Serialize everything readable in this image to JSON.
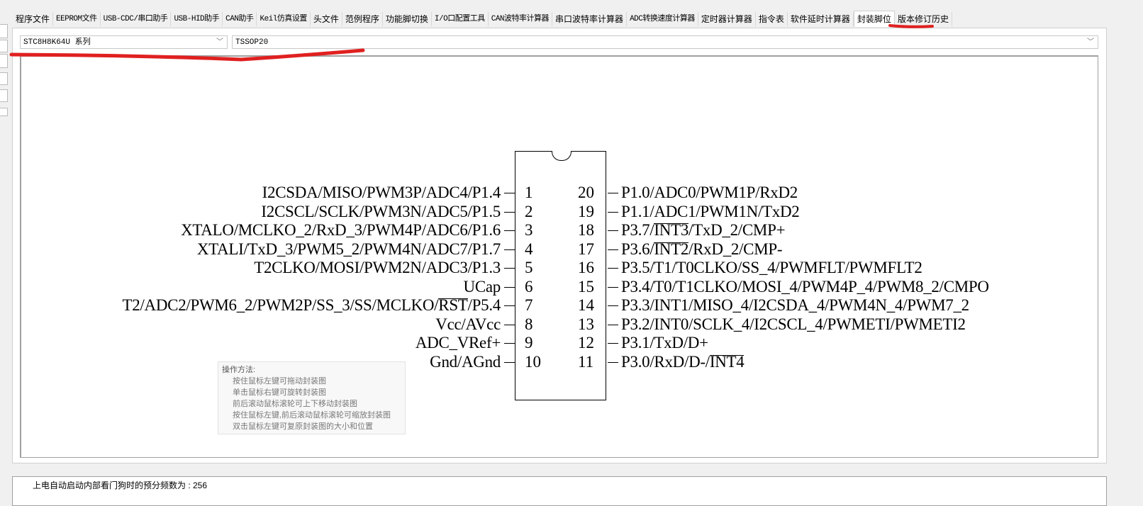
{
  "tabs": [
    {
      "label": "程序文件"
    },
    {
      "label": "EEPROM文件",
      "mono": true
    },
    {
      "label": "USB-CDC/串口助手",
      "mono": true
    },
    {
      "label": "USB-HID助手",
      "mono": true
    },
    {
      "label": "CAN助手",
      "mono": true
    },
    {
      "label": "Keil仿真设置",
      "mono": true
    },
    {
      "label": "头文件"
    },
    {
      "label": "范例程序"
    },
    {
      "label": "功能脚切换"
    },
    {
      "label": "I/O口配置工具",
      "mono": true
    },
    {
      "label": "CAN波特率计算器",
      "mono": true
    },
    {
      "label": "串口波特率计算器"
    },
    {
      "label": "ADC转换速度计算器",
      "mono": true
    },
    {
      "label": "定时器计算器"
    },
    {
      "label": "指令表"
    },
    {
      "label": "软件延时计算器"
    },
    {
      "label": "封装脚位",
      "active": true
    },
    {
      "label": "版本修订历史"
    }
  ],
  "series_select": {
    "value": "STC8H8K64U 系列"
  },
  "package_select": {
    "value": "TSSOP20"
  },
  "chip": {
    "left_pins": [
      {
        "num": "1",
        "label": "I2CSDA/MISO/PWM3P/ADC4/P1.4"
      },
      {
        "num": "2",
        "label": "I2CSCL/SCLK/PWM3N/ADC5/P1.5"
      },
      {
        "num": "3",
        "label": "XTALO/MCLKO_2/RxD_3/PWM4P/ADC6/P1.6"
      },
      {
        "num": "4",
        "label": "XTALI/TxD_3/PWM5_2/PWM4N/ADC7/P1.7"
      },
      {
        "num": "5",
        "label": "T2CLKO/MOSI/PWM2N/ADC3/P1.3"
      },
      {
        "num": "6",
        "label": "UCap"
      },
      {
        "num": "7",
        "label": "T2/ADC2/PWM6_2/PWM2P/SS_3/SS/MCLKO/RST/P5.4",
        "overline": "RST"
      },
      {
        "num": "8",
        "label": "Vcc/AVcc"
      },
      {
        "num": "9",
        "label": "ADC_VRef+"
      },
      {
        "num": "10",
        "label": "Gnd/AGnd"
      }
    ],
    "right_pins": [
      {
        "num": "20",
        "label": "P1.0/ADC0/PWM1P/RxD2"
      },
      {
        "num": "19",
        "label": "P1.1/ADC1/PWM1N/TxD2"
      },
      {
        "num": "18",
        "label": "P3.7/INT3/TxD_2/CMP+",
        "overline": "INT3"
      },
      {
        "num": "17",
        "label": "P3.6/INT2/RxD_2/CMP-",
        "overline": "INT2"
      },
      {
        "num": "16",
        "label": "P3.5/T1/T0CLKO/SS_4/PWMFLT/PWMFLT2"
      },
      {
        "num": "15",
        "label": "P3.4/T0/T1CLKO/MOSI_4/PWM4P_4/PWM8_2/CMPO"
      },
      {
        "num": "14",
        "label": "P3.3/INT1/MISO_4/I2CSDA_4/PWM4N_4/PWM7_2"
      },
      {
        "num": "13",
        "label": "P3.2/INT0/SCLK_4/I2CSCL_4/PWMETI/PWMETI2"
      },
      {
        "num": "12",
        "label": "P3.1/TxD/D+"
      },
      {
        "num": "11",
        "label": "P3.0/RxD/D-/INT4",
        "overline": "INT4"
      }
    ]
  },
  "tooltip": {
    "title": "操作方法:",
    "lines": [
      "按住鼠标左键可拖动封装图",
      "单击鼠标右键可旋转封装图",
      "前后滚动鼠标滚轮可上下移动封装图",
      "按住鼠标左键,前后滚动鼠标滚轮可缩放封装图",
      "双击鼠标左键可复原封装图的大小和位置"
    ]
  },
  "status": {
    "text": "上电自动启动内部看门狗时的预分频数为 : 256"
  },
  "colors": {
    "annotation_red": "#e02020"
  }
}
